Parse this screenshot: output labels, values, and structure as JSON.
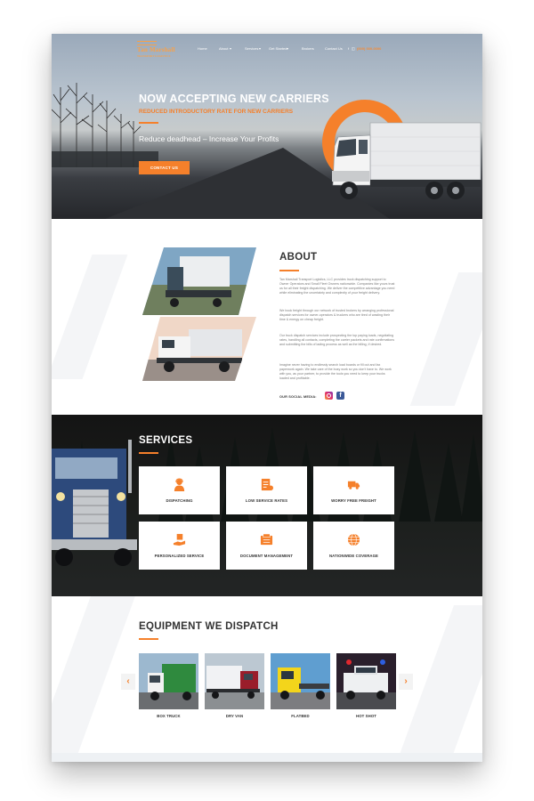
{
  "nav": {
    "logo": "Tan Marshall",
    "logo_sub": "TRANSPORT LOGISTICS",
    "items": [
      "Home",
      "About",
      "Services",
      "Get Started",
      "Brokers",
      "Contact Us"
    ],
    "social": [
      "f",
      "ig"
    ],
    "phone": "(000) 000-0000"
  },
  "hero": {
    "title": "NOW ACCEPTING NEW CARRIERS",
    "subtitle": "REDUCED INTRODUCTORY RATE FOR NEW CARRIERS",
    "tagline": "Reduce deadhead – Increase Your Profits",
    "button": "CONTACT US"
  },
  "about": {
    "title": "ABOUT",
    "paragraphs": [
      "Tan Marshall Transport Logistics, LLC provides truck dispatching support to Owner Operators and Small Fleet Owners nationwide. Companies like yours trust us for all their freight dispatching. We deliver the competitive advantage you need while eliminating the uncertainty and complexity of your freight delivery.",
      "We book freight through our network of trusted brokers by arranging professional dispatch services for owner-operators & truckers who are tired of wasting their time & energy on cheap freight.",
      "Our truck dispatch services include prospecting the top paying loads, negotiating rates, handling all contacts, completing the carrier packets and rate confirmations and submitting the bills of lading process as well as the billing, if desired.",
      "Imagine never having to endlessly search load boards or fill out and fax paperwork again. We take care of the busy work so you don't have to. We work with you, as your partner, to provide the tools you need to keep your trucks loaded and profitable."
    ],
    "social_label": "OUR SOCIAL MEDIA:"
  },
  "services": {
    "title": "SERVICES",
    "items": [
      {
        "label": "DISPATCHING",
        "icon": "dispatcher-icon"
      },
      {
        "label": "LOW SERVICE RATES",
        "icon": "rates-document-icon"
      },
      {
        "label": "WORRY FREE FREIGHT",
        "icon": "delivery-truck-icon"
      },
      {
        "label": "PERSONALIZED SERVICE",
        "icon": "hand-service-icon"
      },
      {
        "label": "DOCUMENT MANAGEMENT",
        "icon": "documents-icon"
      },
      {
        "label": "NATIONWIDE COVERAGE",
        "icon": "globe-icon"
      }
    ]
  },
  "equipment": {
    "title": "EQUIPMENT WE DISPATCH",
    "prev": "‹",
    "next": "›",
    "items": [
      "BOX TRUCK",
      "DRY VAN",
      "FLATBED",
      "HOT SHOT"
    ]
  },
  "colors": {
    "accent": "#f5802b",
    "dark": "#1b1e1c",
    "text": "#333333"
  }
}
